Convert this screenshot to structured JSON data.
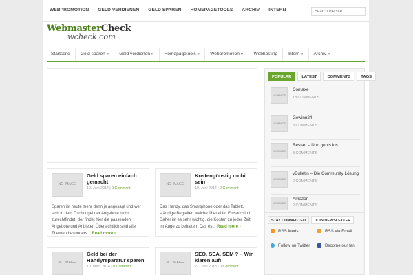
{
  "top_nav": [
    "WEBPROMOTION",
    "GELD VERDIENEN",
    "GELD SPAREN",
    "HOMEPAGETOOLS",
    "ARCHIV",
    "INTERN"
  ],
  "search": {
    "placeholder": "Search the site..."
  },
  "logo": {
    "line1_green": "Webmaster",
    "line1_dark": "Check",
    "line2": "wcheck.com"
  },
  "main_nav": [
    "Startseite",
    "Geld sparen »",
    "Geld verdienen »",
    "Homepagetools »",
    "Webpromotion »",
    "Webhosting",
    "Intern »",
    "Archiv »"
  ],
  "posts": [
    {
      "thumb": "NO IMAGE",
      "title": "Geld sparen einfach gemacht",
      "date": "10. Juni 2014",
      "comments": "0 Comment",
      "excerpt": "Sparen ist heute mehr denn je angesagt und wer sich in dem Dschungel der Angebote nicht zurechtfindet, der findet hier die passenden Angebote und Anbieter. Übersichtlich sind alle Themen besonders...",
      "more": "Read more ›"
    },
    {
      "thumb": "NO IMAGE",
      "title": "Kostengünstig mobil sein",
      "date": "10. Juni 2014",
      "comments": "0 Comment",
      "excerpt": "Das Handy, das Smartphone oder das Tablett, ständige Begleiter, welche überall im Einsatz sind. Daher ist es sehr wichtig, die Kosten zu jeder Zeit im Auge zu behalten. Das es...",
      "more": "Read more ›"
    },
    {
      "thumb": "NO IMAGE",
      "title": "Geld bei der Handyreparatur sparen",
      "date": "10. März 2014",
      "comments": "0 Comment"
    },
    {
      "thumb": "NO IMAGE",
      "title": "SEO, SEA, SEM ? – Wir klären auf!",
      "date": "21. Juni 2013",
      "comments": "0 Comment"
    }
  ],
  "sidebar": {
    "tabs": [
      "POPULAR",
      "LATEST",
      "COMMENTS",
      "TAGS"
    ],
    "items": [
      {
        "thumb": "NO IMAGE",
        "title": "Contaxe",
        "comments": "18 COMMENTS"
      },
      {
        "thumb": "NO IMAGE",
        "title": "Gewinn24",
        "comments": "3 COMMENTS"
      },
      {
        "thumb": "NO IMAGE",
        "title": "Restart – Nun gehts los",
        "comments": "3 COMMENTS"
      },
      {
        "thumb": "NO IMAGE",
        "title": "vBulletin – Die Community Lösung",
        "comments": "2 COMMENTS"
      },
      {
        "thumb": "NO IMAGE",
        "title": "Amazon",
        "comments": "2 COMMENTS"
      }
    ]
  },
  "stay": {
    "tabs": [
      "STAY CONNECTED",
      "JOIN NEWSLETTER"
    ],
    "links": [
      {
        "icon": "rss-icon",
        "label": "RSS feeds",
        "color": "#f7931e"
      },
      {
        "icon": "rss-email-icon",
        "label": "RSS via Email",
        "color": "#e8a33d"
      },
      {
        "icon": "twitter-icon",
        "label": "Follow on Twitter",
        "color": "#3aaae1"
      },
      {
        "icon": "facebook-icon",
        "label": "Become our fan",
        "color": "#3b5998"
      }
    ]
  },
  "colors": {
    "accent": "#6aa52c"
  }
}
